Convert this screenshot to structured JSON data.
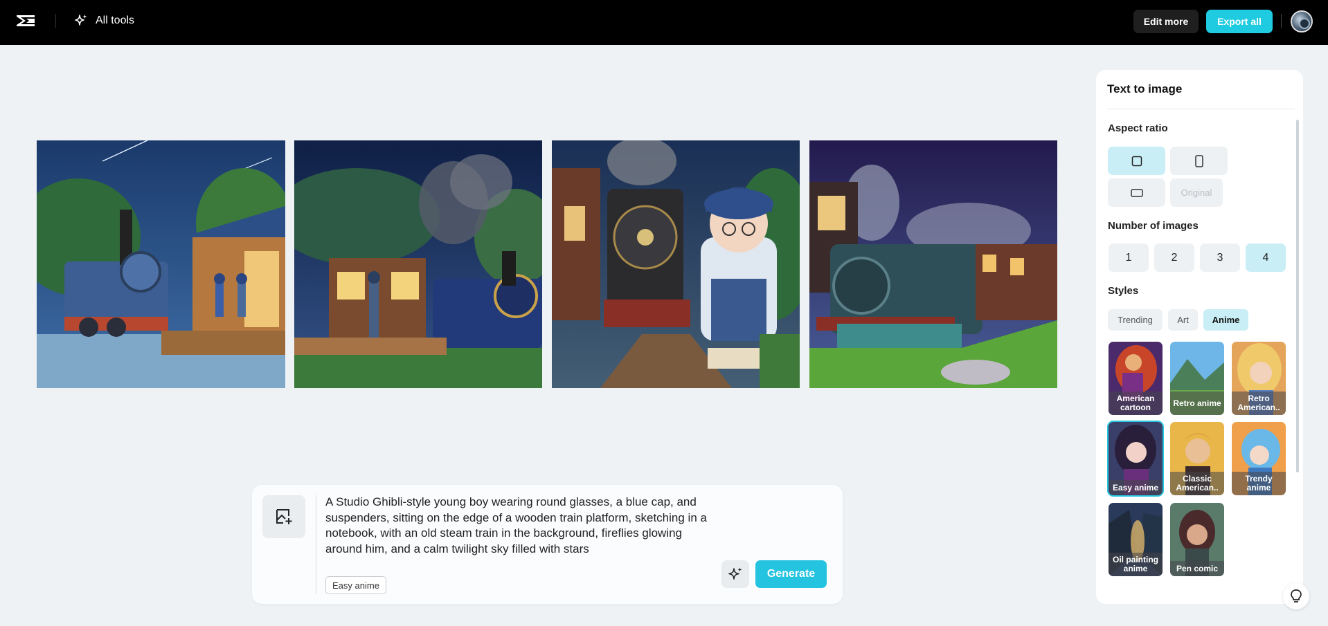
{
  "topbar": {
    "all_tools_label": "All tools",
    "edit_more_label": "Edit more",
    "export_all_label": "Export all"
  },
  "images": [
    {
      "name": "generated-image-1"
    },
    {
      "name": "generated-image-2"
    },
    {
      "name": "generated-image-3"
    },
    {
      "name": "generated-image-4"
    }
  ],
  "prompt": {
    "text": "A Studio Ghibli-style young boy wearing round glasses, a blue cap, and suspenders, sitting on the edge of a wooden train platform, sketching in a notebook, with an old steam train in the background, fireflies glowing around him, and a calm twilight sky filled with stars",
    "style_chip": "Easy anime",
    "generate_label": "Generate"
  },
  "panel": {
    "title": "Text to image",
    "aspect_ratio_label": "Aspect ratio",
    "aspect_original_label": "Original",
    "num_images_label": "Number of images",
    "num_options": [
      "1",
      "2",
      "3",
      "4"
    ],
    "num_selected": "4",
    "styles_label": "Styles",
    "style_tabs": [
      "Trending",
      "Art",
      "Anime"
    ],
    "style_tab_selected": "Anime",
    "style_cards": [
      "American cartoon",
      "Retro anime",
      "Retro American..",
      "Easy anime",
      "Classic American..",
      "Trendy anime",
      "Oil painting anime",
      "Pen comic"
    ],
    "style_selected": "Easy anime"
  },
  "colors": {
    "accent": "#1ecbe1",
    "selected_bg": "#c9eef5",
    "topbar_bg": "#000000",
    "canvas_bg": "#eef2f5"
  }
}
